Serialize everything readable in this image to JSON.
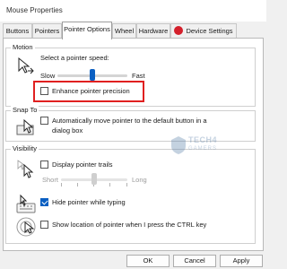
{
  "window": {
    "title": "Mouse Properties"
  },
  "tabs": [
    {
      "label": "Buttons",
      "active": false
    },
    {
      "label": "Pointers",
      "active": false
    },
    {
      "label": "Pointer Options",
      "active": true
    },
    {
      "label": "Wheel",
      "active": false
    },
    {
      "label": "Hardware",
      "active": false
    },
    {
      "label": "Device Settings",
      "active": false,
      "icon": "device-settings-icon"
    }
  ],
  "motion": {
    "group_label": "Motion",
    "speed_label": "Select a pointer speed:",
    "slow_label": "Slow",
    "fast_label": "Fast",
    "speed_level": 0.5,
    "enhance_precision_label": "Enhance pointer precision",
    "enhance_precision_checked": false
  },
  "snap_to": {
    "group_label": "Snap To",
    "checkbox_label_line1": "Automatically move pointer to the default button in a",
    "checkbox_label_line2": "dialog box",
    "checked": false
  },
  "visibility": {
    "group_label": "Visibility",
    "trails_label": "Display pointer trails",
    "trails_checked": false,
    "short_label": "Short",
    "long_label": "Long",
    "trail_level": 0.5,
    "hide_typing_label": "Hide pointer while typing",
    "hide_typing_checked": true,
    "show_location_label": "Show location of pointer when I press the CTRL key",
    "show_location_checked": false
  },
  "watermark": {
    "line1": "TECH4",
    "line2": "GAMERS"
  },
  "footer": {
    "ok": "OK",
    "cancel": "Cancel",
    "apply": "Apply"
  },
  "colors": {
    "accent": "#0a5fc2",
    "highlight": "#e02020",
    "device_icon": "#d4202c"
  }
}
